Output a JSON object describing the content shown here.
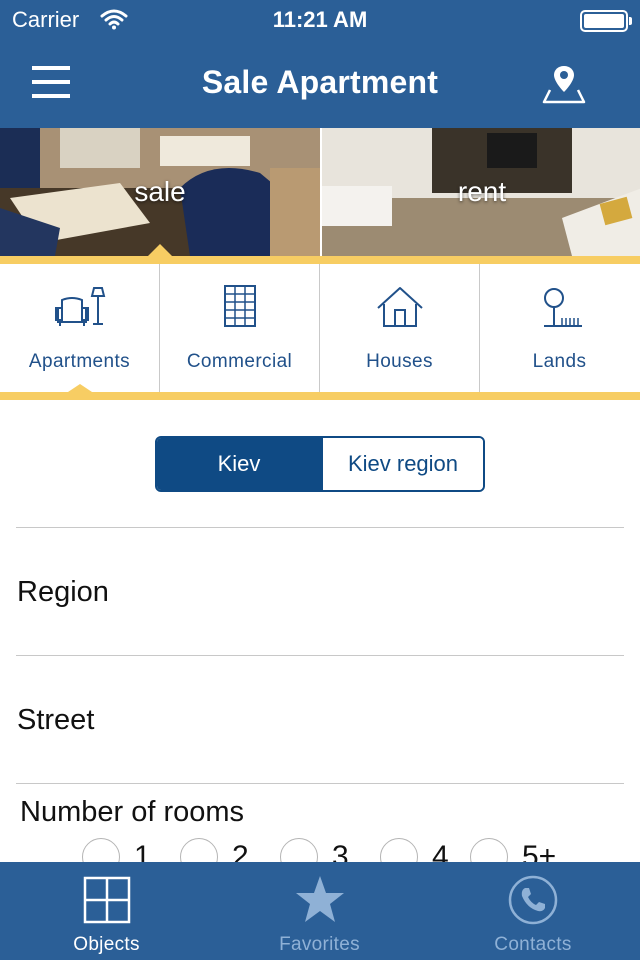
{
  "status_bar": {
    "carrier": "Carrier",
    "time": "11:21 AM"
  },
  "header": {
    "title": "Sale Apartment",
    "menu_icon": "hamburger-menu-icon",
    "map_icon": "map-pin-icon"
  },
  "hero": {
    "sale_label": "sale",
    "rent_label": "rent"
  },
  "categories": [
    {
      "label": "Apartments",
      "icon": "armchair-lamp-icon"
    },
    {
      "label": "Commercial",
      "icon": "office-building-icon"
    },
    {
      "label": "Houses",
      "icon": "house-icon"
    },
    {
      "label": "Lands",
      "icon": "tree-fence-icon"
    }
  ],
  "location_toggle": {
    "options": [
      "Kiev",
      "Kiev region"
    ],
    "selected": "Kiev"
  },
  "form": {
    "region_label": "Region",
    "street_label": "Street",
    "rooms_label": "Number of rooms",
    "room_options": [
      "1",
      "2",
      "3",
      "4",
      "5+"
    ]
  },
  "tabbar": {
    "tabs": [
      {
        "label": "Objects",
        "icon": "grid-icon",
        "active": true
      },
      {
        "label": "Favorites",
        "icon": "star-icon",
        "active": false
      },
      {
        "label": "Contacts",
        "icon": "phone-icon",
        "active": false
      }
    ]
  },
  "colors": {
    "brand_blue": "#2b5f97",
    "dark_blue": "#0f4a84",
    "accent_gold": "#f7cd63",
    "inactive_tab": "#8fb1d6"
  }
}
